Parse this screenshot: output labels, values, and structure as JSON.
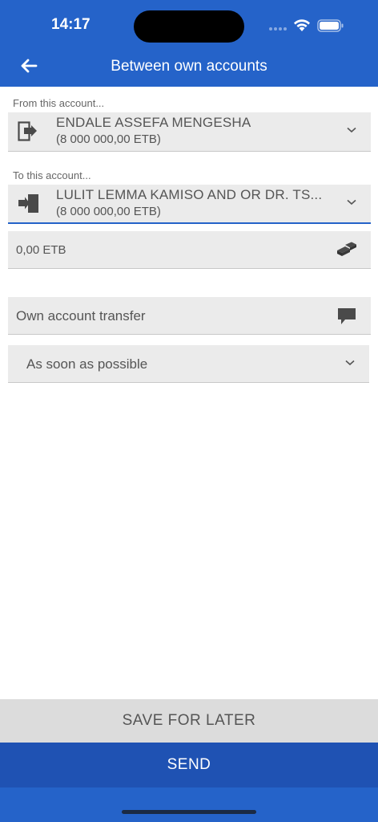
{
  "status_bar": {
    "time": "14:17"
  },
  "header": {
    "title": "Between own accounts"
  },
  "from_account": {
    "label": "From this account...",
    "name": "ENDALE ASSEFA MENGESHA",
    "balance": "(8 000 000,00 ETB)"
  },
  "to_account": {
    "label": "To this account...",
    "name": "LULIT LEMMA KAMISO AND OR DR. TS...",
    "balance": "(8 000 000,00 ETB)"
  },
  "amount": {
    "value": "0,00 ETB"
  },
  "description": {
    "value": "Own account transfer"
  },
  "schedule": {
    "selected": "As soon as possible"
  },
  "actions": {
    "save_label": "SAVE FOR LATER",
    "send_label": "SEND"
  },
  "colors": {
    "primary": "#2563c9",
    "send": "#1f52b3",
    "field_bg": "#ebebeb"
  }
}
